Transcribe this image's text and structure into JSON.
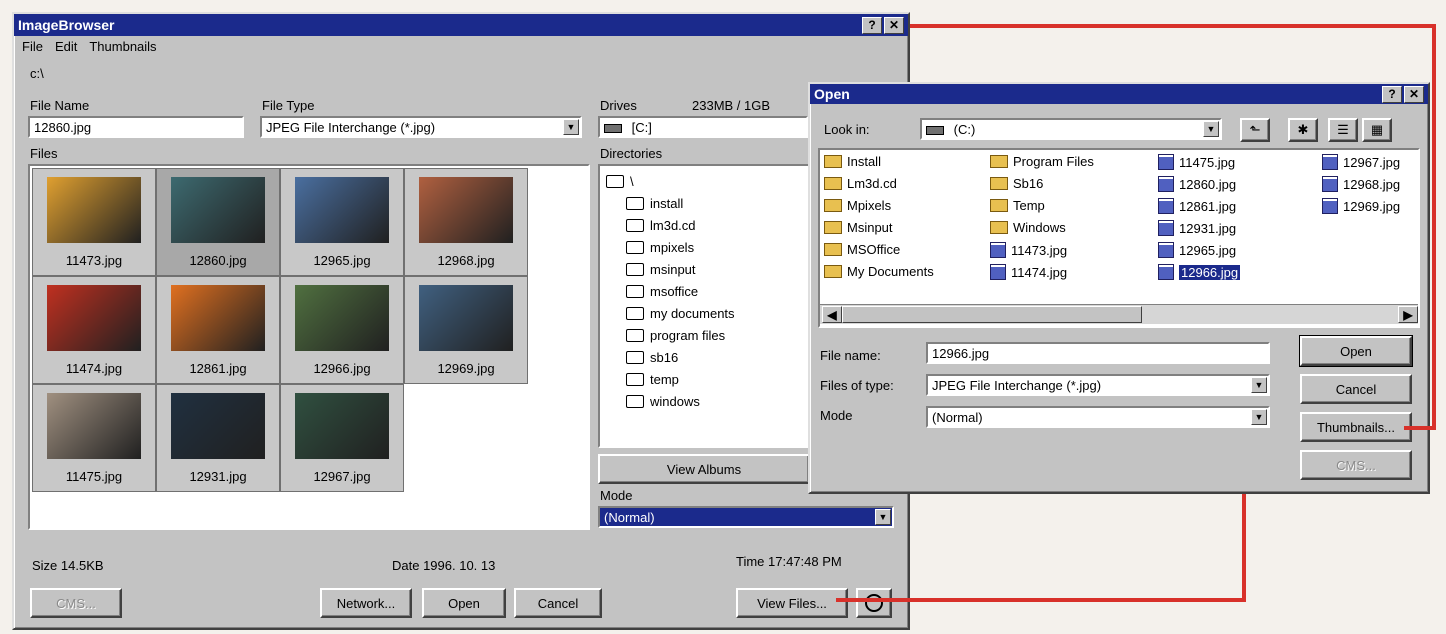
{
  "browser": {
    "title": "ImageBrowser",
    "menu": [
      "File",
      "Edit",
      "Thumbnails"
    ],
    "path": "c:\\",
    "file_name_label": "File Name",
    "file_name_value": "12860.jpg",
    "file_type_label": "File Type",
    "file_type_value": "JPEG File Interchange (*.jpg)",
    "files_label": "Files",
    "thumbnails": [
      {
        "name": "11473.jpg",
        "color": "#e0a030"
      },
      {
        "name": "12860.jpg",
        "color": "#3d6a70"
      },
      {
        "name": "12965.jpg",
        "color": "#4a6fa0"
      },
      {
        "name": "12968.jpg",
        "color": "#b06040"
      },
      {
        "name": "11474.jpg",
        "color": "#c03020"
      },
      {
        "name": "12861.jpg",
        "color": "#e07020"
      },
      {
        "name": "12966.jpg",
        "color": "#507040"
      },
      {
        "name": "12969.jpg",
        "color": "#406080"
      },
      {
        "name": "11475.jpg",
        "color": "#a09080"
      },
      {
        "name": "12931.jpg",
        "color": "#203040"
      },
      {
        "name": "12967.jpg",
        "color": "#305040"
      }
    ],
    "drives_label": "Drives",
    "drives_space": "233MB / 1GB",
    "drive_value": "[C:]",
    "directories_label": "Directories",
    "directories": [
      "\\",
      "install",
      "lm3d.cd",
      "mpixels",
      "msinput",
      "msoffice",
      "my documents",
      "program files",
      "sb16",
      "temp",
      "windows"
    ],
    "view_albums": "View Albums",
    "mode_label": "Mode",
    "mode_value": "(Normal)",
    "size": "Size  14.5KB",
    "date": "Date 1996. 10. 13",
    "time": "Time 17:47:48 PM",
    "buttons": {
      "cms": "CMS...",
      "network": "Network...",
      "open": "Open",
      "cancel": "Cancel",
      "view_files": "View Files..."
    }
  },
  "open_dialog": {
    "title": "Open",
    "look_in_label": "Look in:",
    "look_in_value": "(C:)",
    "columns": [
      [
        {
          "name": "Install",
          "kind": "folder"
        },
        {
          "name": "Lm3d.cd",
          "kind": "folder"
        },
        {
          "name": "Mpixels",
          "kind": "folder"
        },
        {
          "name": "Msinput",
          "kind": "folder"
        },
        {
          "name": "MSOffice",
          "kind": "folder"
        },
        {
          "name": "My Documents",
          "kind": "folder"
        }
      ],
      [
        {
          "name": "Program Files",
          "kind": "folder"
        },
        {
          "name": "Sb16",
          "kind": "folder"
        },
        {
          "name": "Temp",
          "kind": "folder"
        },
        {
          "name": "Windows",
          "kind": "folder"
        },
        {
          "name": "11473.jpg",
          "kind": "jpg"
        },
        {
          "name": "11474.jpg",
          "kind": "jpg"
        }
      ],
      [
        {
          "name": "11475.jpg",
          "kind": "jpg"
        },
        {
          "name": "12860.jpg",
          "kind": "jpg"
        },
        {
          "name": "12861.jpg",
          "kind": "jpg"
        },
        {
          "name": "12931.jpg",
          "kind": "jpg"
        },
        {
          "name": "12965.jpg",
          "kind": "jpg"
        },
        {
          "name": "12966.jpg",
          "kind": "jpg",
          "selected": true
        }
      ],
      [
        {
          "name": "12967.jpg",
          "kind": "jpg"
        },
        {
          "name": "12968.jpg",
          "kind": "jpg"
        },
        {
          "name": "12969.jpg",
          "kind": "jpg"
        }
      ]
    ],
    "file_name_label": "File name:",
    "file_name_value": "12966.jpg",
    "files_of_type_label": "Files of type:",
    "files_of_type_value": "JPEG File Interchange (*.jpg)",
    "mode_label": "Mode",
    "mode_value": "(Normal)",
    "buttons": {
      "open": "Open",
      "cancel": "Cancel",
      "thumbnails": "Thumbnails...",
      "cms": "CMS..."
    }
  }
}
